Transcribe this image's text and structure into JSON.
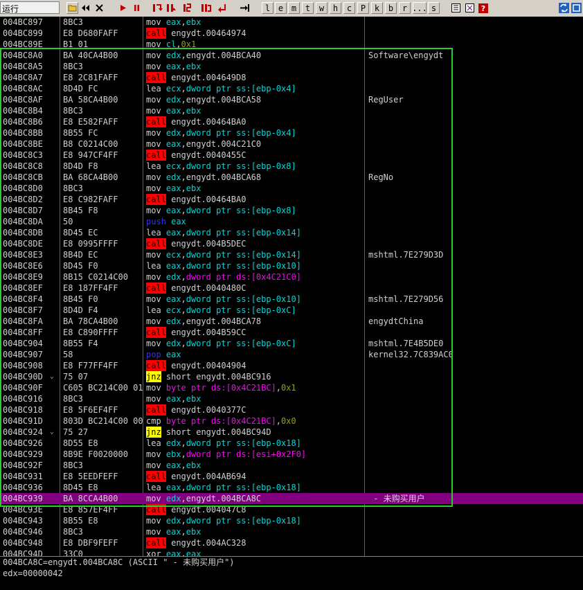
{
  "toolbar": {
    "run_label": "运行",
    "letters": [
      "l",
      "e",
      "m",
      "t",
      "w",
      "h",
      "c",
      "P",
      "k",
      "b",
      "r",
      "...",
      "s"
    ]
  },
  "colors": {
    "selection": "#800080",
    "highlight_box": "#2ecc2e",
    "call_bg": "#ff0000",
    "jcc_bg": "#ffff00"
  },
  "rows": [
    {
      "addr": "004BC897",
      "hex": "8BC3",
      "mn": "mov",
      "mk": "mov",
      "args": [
        [
          "eax",
          "reg"
        ],
        [
          ",",
          "plain"
        ],
        [
          "ebx",
          "reg"
        ]
      ],
      "cmt": ""
    },
    {
      "addr": "004BC899",
      "hex": "E8 D680FAFF",
      "mn": "call",
      "mk": "call",
      "args": [
        [
          "engydt.00464974",
          "plain"
        ]
      ],
      "cmt": ""
    },
    {
      "addr": "004BC89E",
      "hex": "B1 01",
      "mn": "mov",
      "mk": "mov",
      "args": [
        [
          "cl",
          "reg"
        ],
        [
          ",",
          "plain"
        ],
        [
          "0x1",
          "imm"
        ]
      ],
      "cmt": ""
    },
    {
      "addr": "004BC8A0",
      "hex": "BA 40CA4B00",
      "mn": "mov",
      "mk": "mov",
      "args": [
        [
          "edx",
          "reg"
        ],
        [
          ",engydt.004BCA40",
          "plain"
        ]
      ],
      "cmt": "Software\\engydt"
    },
    {
      "addr": "004BC8A5",
      "hex": "8BC3",
      "mn": "mov",
      "mk": "mov",
      "args": [
        [
          "eax",
          "reg"
        ],
        [
          ",",
          "plain"
        ],
        [
          "ebx",
          "reg"
        ]
      ],
      "cmt": ""
    },
    {
      "addr": "004BC8A7",
      "hex": "E8 2C81FAFF",
      "mn": "call",
      "mk": "call",
      "args": [
        [
          "engydt.004649D8",
          "plain"
        ]
      ],
      "cmt": ""
    },
    {
      "addr": "004BC8AC",
      "hex": "8D4D FC",
      "mn": "lea",
      "mk": "mov",
      "args": [
        [
          "ecx",
          "reg"
        ],
        [
          ",",
          "plain"
        ],
        [
          "dword ptr ss:[ebp-0x4]",
          "mem2"
        ]
      ],
      "cmt": ""
    },
    {
      "addr": "004BC8AF",
      "hex": "BA 58CA4B00",
      "mn": "mov",
      "mk": "mov",
      "args": [
        [
          "edx",
          "reg"
        ],
        [
          ",engydt.004BCA58",
          "plain"
        ]
      ],
      "cmt": "RegUser"
    },
    {
      "addr": "004BC8B4",
      "hex": "8BC3",
      "mn": "mov",
      "mk": "mov",
      "args": [
        [
          "eax",
          "reg"
        ],
        [
          ",",
          "plain"
        ],
        [
          "ebx",
          "reg"
        ]
      ],
      "cmt": ""
    },
    {
      "addr": "004BC8B6",
      "hex": "E8 E582FAFF",
      "mn": "call",
      "mk": "call",
      "args": [
        [
          "engydt.00464BA0",
          "plain"
        ]
      ],
      "cmt": ""
    },
    {
      "addr": "004BC8BB",
      "hex": "8B55 FC",
      "mn": "mov",
      "mk": "mov",
      "args": [
        [
          "edx",
          "reg"
        ],
        [
          ",",
          "plain"
        ],
        [
          "dword ptr ss:[ebp-0x4]",
          "mem2"
        ]
      ],
      "cmt": ""
    },
    {
      "addr": "004BC8BE",
      "hex": "B8 C0214C00",
      "mn": "mov",
      "mk": "mov",
      "args": [
        [
          "eax",
          "reg"
        ],
        [
          ",engydt.004C21C0",
          "plain"
        ]
      ],
      "cmt": ""
    },
    {
      "addr": "004BC8C3",
      "hex": "E8 947CF4FF",
      "mn": "call",
      "mk": "call",
      "args": [
        [
          "engydt.0040455C",
          "plain"
        ]
      ],
      "cmt": ""
    },
    {
      "addr": "004BC8C8",
      "hex": "8D4D F8",
      "mn": "lea",
      "mk": "mov",
      "args": [
        [
          "ecx",
          "reg"
        ],
        [
          ",",
          "plain"
        ],
        [
          "dword ptr ss:[ebp-0x8]",
          "mem2"
        ]
      ],
      "cmt": ""
    },
    {
      "addr": "004BC8CB",
      "hex": "BA 68CA4B00",
      "mn": "mov",
      "mk": "mov",
      "args": [
        [
          "edx",
          "reg"
        ],
        [
          ",engydt.004BCA68",
          "plain"
        ]
      ],
      "cmt": "RegNo"
    },
    {
      "addr": "004BC8D0",
      "hex": "8BC3",
      "mn": "mov",
      "mk": "mov",
      "args": [
        [
          "eax",
          "reg"
        ],
        [
          ",",
          "plain"
        ],
        [
          "ebx",
          "reg"
        ]
      ],
      "cmt": ""
    },
    {
      "addr": "004BC8D2",
      "hex": "E8 C982FAFF",
      "mn": "call",
      "mk": "call",
      "args": [
        [
          "engydt.00464BA0",
          "plain"
        ]
      ],
      "cmt": ""
    },
    {
      "addr": "004BC8D7",
      "hex": "8B45 F8",
      "mn": "mov",
      "mk": "mov",
      "args": [
        [
          "eax",
          "reg"
        ],
        [
          ",",
          "plain"
        ],
        [
          "dword ptr ss:[ebp-0x8]",
          "mem2"
        ]
      ],
      "cmt": ""
    },
    {
      "addr": "004BC8DA",
      "hex": "50",
      "mn": "push",
      "mk": "push",
      "args": [
        [
          "eax",
          "reg"
        ]
      ],
      "cmt": ""
    },
    {
      "addr": "004BC8DB",
      "hex": "8D45 EC",
      "mn": "lea",
      "mk": "mov",
      "args": [
        [
          "eax",
          "reg"
        ],
        [
          ",",
          "plain"
        ],
        [
          "dword ptr ss:[ebp-0x14]",
          "mem2"
        ]
      ],
      "cmt": ""
    },
    {
      "addr": "004BC8DE",
      "hex": "E8 0995FFFF",
      "mn": "call",
      "mk": "call",
      "args": [
        [
          "engydt.004B5DEC",
          "plain"
        ]
      ],
      "cmt": ""
    },
    {
      "addr": "004BC8E3",
      "hex": "8B4D EC",
      "mn": "mov",
      "mk": "mov",
      "args": [
        [
          "ecx",
          "reg"
        ],
        [
          ",",
          "plain"
        ],
        [
          "dword ptr ss:[ebp-0x14]",
          "mem2"
        ]
      ],
      "cmt": "mshtml.7E279D3D"
    },
    {
      "addr": "004BC8E6",
      "hex": "8D45 F0",
      "mn": "lea",
      "mk": "mov",
      "args": [
        [
          "eax",
          "reg"
        ],
        [
          ",",
          "plain"
        ],
        [
          "dword ptr ss:[ebp-0x10]",
          "mem2"
        ]
      ],
      "cmt": ""
    },
    {
      "addr": "004BC8E9",
      "hex": "8B15 C0214C00",
      "mn": "mov",
      "mk": "mov",
      "args": [
        [
          "edx",
          "reg"
        ],
        [
          ",",
          "plain"
        ],
        [
          "dword ptr ds:[0x4C21C0]",
          "mem"
        ]
      ],
      "cmt": ""
    },
    {
      "addr": "004BC8EF",
      "hex": "E8 187FF4FF",
      "mn": "call",
      "mk": "call",
      "args": [
        [
          "engydt.0040480C",
          "plain"
        ]
      ],
      "cmt": ""
    },
    {
      "addr": "004BC8F4",
      "hex": "8B45 F0",
      "mn": "mov",
      "mk": "mov",
      "args": [
        [
          "eax",
          "reg"
        ],
        [
          ",",
          "plain"
        ],
        [
          "dword ptr ss:[ebp-0x10]",
          "mem2"
        ]
      ],
      "cmt": "mshtml.7E279D56"
    },
    {
      "addr": "004BC8F7",
      "hex": "8D4D F4",
      "mn": "lea",
      "mk": "mov",
      "args": [
        [
          "ecx",
          "reg"
        ],
        [
          ",",
          "plain"
        ],
        [
          "dword ptr ss:[ebp-0xC]",
          "mem2"
        ]
      ],
      "cmt": ""
    },
    {
      "addr": "004BC8FA",
      "hex": "BA 78CA4B00",
      "mn": "mov",
      "mk": "mov",
      "args": [
        [
          "edx",
          "reg"
        ],
        [
          ",engydt.004BCA78",
          "plain"
        ]
      ],
      "cmt": "engydtChina"
    },
    {
      "addr": "004BC8FF",
      "hex": "E8 C890FFFF",
      "mn": "call",
      "mk": "call",
      "args": [
        [
          "engydt.004B59CC",
          "plain"
        ]
      ],
      "cmt": ""
    },
    {
      "addr": "004BC904",
      "hex": "8B55 F4",
      "mn": "mov",
      "mk": "mov",
      "args": [
        [
          "edx",
          "reg"
        ],
        [
          ",",
          "plain"
        ],
        [
          "dword ptr ss:[ebp-0xC]",
          "mem2"
        ]
      ],
      "cmt": "mshtml.7E4B5DE0"
    },
    {
      "addr": "004BC907",
      "hex": "58",
      "mn": "pop",
      "mk": "pop",
      "args": [
        [
          "eax",
          "reg"
        ]
      ],
      "cmt": "kernel32.7C839AC0"
    },
    {
      "addr": "004BC908",
      "hex": "E8 F77FF4FF",
      "mn": "call",
      "mk": "call",
      "args": [
        [
          "engydt.00404904",
          "plain"
        ]
      ],
      "cmt": ""
    },
    {
      "addr": "004BC90D",
      "jm": "⌄",
      "hex": "75 07",
      "mn": "jnz",
      "mk": "jcc",
      "args": [
        [
          "short engydt.004BC916",
          "plain"
        ]
      ],
      "cmt": ""
    },
    {
      "addr": "004BC90F",
      "hex": "C605 BC214C00 01",
      "mn": "mov",
      "mk": "mov",
      "args": [
        [
          "byte ptr ds:[0x4C21BC]",
          "mem"
        ],
        [
          ",",
          "plain"
        ],
        [
          "0x1",
          "imm"
        ]
      ],
      "cmt": ""
    },
    {
      "addr": "004BC916",
      "hex": "8BC3",
      "mn": "mov",
      "mk": "mov",
      "args": [
        [
          "eax",
          "reg"
        ],
        [
          ",",
          "plain"
        ],
        [
          "ebx",
          "reg"
        ]
      ],
      "cmt": ""
    },
    {
      "addr": "004BC918",
      "hex": "E8 5F6EF4FF",
      "mn": "call",
      "mk": "call",
      "args": [
        [
          "engydt.0040377C",
          "plain"
        ]
      ],
      "cmt": ""
    },
    {
      "addr": "004BC91D",
      "hex": "803D BC214C00 00",
      "mn": "cmp",
      "mk": "mov",
      "args": [
        [
          "byte ptr ds:[0x4C21BC]",
          "mem"
        ],
        [
          ",",
          "plain"
        ],
        [
          "0x0",
          "imm"
        ]
      ],
      "cmt": ""
    },
    {
      "addr": "004BC924",
      "jm": "⌄",
      "hex": "75 27",
      "mn": "jnz",
      "mk": "jcc",
      "args": [
        [
          "short engydt.004BC94D",
          "plain"
        ]
      ],
      "cmt": ""
    },
    {
      "addr": "004BC926",
      "hex": "8D55 E8",
      "mn": "lea",
      "mk": "mov",
      "args": [
        [
          "edx",
          "reg"
        ],
        [
          ",",
          "plain"
        ],
        [
          "dword ptr ss:[ebp-0x18]",
          "mem2"
        ]
      ],
      "cmt": ""
    },
    {
      "addr": "004BC929",
      "hex": "8B9E F0020000",
      "mn": "mov",
      "mk": "mov",
      "args": [
        [
          "ebx",
          "reg"
        ],
        [
          ",",
          "plain"
        ],
        [
          "dword ptr ds:[esi+0x2F0]",
          "mem"
        ]
      ],
      "cmt": ""
    },
    {
      "addr": "004BC92F",
      "hex": "8BC3",
      "mn": "mov",
      "mk": "mov",
      "args": [
        [
          "eax",
          "reg"
        ],
        [
          ",",
          "plain"
        ],
        [
          "ebx",
          "reg"
        ]
      ],
      "cmt": ""
    },
    {
      "addr": "004BC931",
      "hex": "E8 5EEDFEFF",
      "mn": "call",
      "mk": "call",
      "args": [
        [
          "engydt.004AB694",
          "plain"
        ]
      ],
      "cmt": ""
    },
    {
      "addr": "004BC936",
      "hex": "8D45 E8",
      "mn": "lea",
      "mk": "mov",
      "args": [
        [
          "eax",
          "reg"
        ],
        [
          ",",
          "plain"
        ],
        [
          "dword ptr ss:[ebp-0x18]",
          "mem2"
        ]
      ],
      "cmt": ""
    },
    {
      "addr": "004BC939",
      "hex": "BA 8CCA4B00",
      "mn": "mov",
      "mk": "mov",
      "args": [
        [
          "edx",
          "reg"
        ],
        [
          ",engydt.004BCA8C",
          "plain"
        ]
      ],
      "cmt": " - 未购买用户",
      "sel": true
    },
    {
      "addr": "004BC93E",
      "hex": "E8 857EF4FF",
      "mn": "call",
      "mk": "call",
      "args": [
        [
          "engydt.004047C8",
          "plain"
        ]
      ],
      "cmt": ""
    },
    {
      "addr": "004BC943",
      "hex": "8B55 E8",
      "mn": "mov",
      "mk": "mov",
      "args": [
        [
          "edx",
          "reg"
        ],
        [
          ",",
          "plain"
        ],
        [
          "dword ptr ss:[ebp-0x18]",
          "mem2"
        ]
      ],
      "cmt": ""
    },
    {
      "addr": "004BC946",
      "hex": "8BC3",
      "mn": "mov",
      "mk": "mov",
      "args": [
        [
          "eax",
          "reg"
        ],
        [
          ",",
          "plain"
        ],
        [
          "ebx",
          "reg"
        ]
      ],
      "cmt": ""
    },
    {
      "addr": "004BC948",
      "hex": "E8 DBF9FEFF",
      "mn": "call",
      "mk": "call",
      "args": [
        [
          "engydt.004AC328",
          "plain"
        ]
      ],
      "cmt": ""
    },
    {
      "addr": "004BC94D",
      "hex": "33C0",
      "mn": "xor",
      "mk": "mov",
      "args": [
        [
          "eax",
          "reg"
        ],
        [
          ",",
          "plain"
        ],
        [
          "eax",
          "reg"
        ]
      ],
      "cmt": ""
    }
  ],
  "info": {
    "line1": "004BCA8C=engydt.004BCA8C (ASCII \" - 未购买用户\")",
    "line2": "edx=00000042"
  }
}
